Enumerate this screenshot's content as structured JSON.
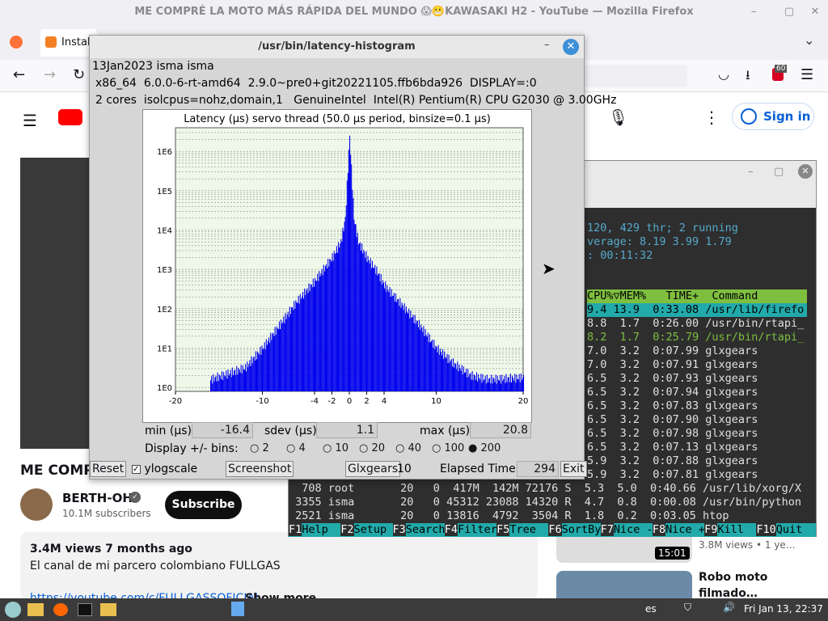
{
  "firefox": {
    "window_title": "ME COMPRÉ LA MOTO MÁS RÁPIDA DEL MUNDO 😱😬KAWASAKI H2 - YouTube — Mozilla Firefox",
    "tab_label": "Instal",
    "badge": "60"
  },
  "youtube": {
    "signin": "Sign in",
    "video_title": "ME COMP",
    "channel": "BERTH-OH",
    "subscribers": "10.1M subscribers",
    "subscribe": "Subscribe",
    "views": "3.4M views  7 months ago",
    "description": "El canal de mi parcero colombiano FULLGAS",
    "link": "https://youtube.com/c/FULLGASSOFICIAL",
    "show_more": "Show more",
    "side_time": "15:01",
    "side_views": "3.8M views  • 1 ye…",
    "side_title1": "Robo moto",
    "side_title2": "filmado…"
  },
  "latency": {
    "title": "/usr/bin/latency-histogram",
    "line1": "13Jan2023 isma isma",
    "line2": "x86_64  6.0.0-6-rt-amd64  2.9.0~pre0+git20221105.ffb6bda926  DISPLAY=:0",
    "line3": "2 cores  isolcpus=nohz,domain,1   GenuineIntel  Intel(R) Pentium(R) CPU G2030 @ 3.00GHz",
    "min_label": "min (µs)",
    "min_value": "-16.4",
    "sdev_label": "sdev (µs)",
    "sdev_value": "1.1",
    "max_label": "max (µs)",
    "max_value": "20.8",
    "bins_label": "Display +/- bins:",
    "bins": [
      "2",
      "4",
      "10",
      "20",
      "40",
      "100",
      "200"
    ],
    "bins_selected": "200",
    "reset": "Reset",
    "ylogscale": "ylogscale",
    "screenshot": "Screenshot",
    "glxgears": "Glxgears",
    "glxgears_count": "10",
    "elapsed_label": "Elapsed Time:",
    "elapsed_value": "294",
    "exit": "Exit"
  },
  "chart_data": {
    "type": "bar",
    "title": "Latency (µs) servo thread (50.0 µs period, binsize=0.1 µs)",
    "xlim": [
      -20,
      20
    ],
    "y_scale": "log",
    "x_ticks": [
      "-20",
      "-10",
      "-4",
      "-2",
      "0",
      "2",
      "4",
      "10",
      "20"
    ],
    "y_ticks": [
      "1E0",
      "1E1",
      "1E2",
      "1E3",
      "1E4",
      "1E5",
      "1E6"
    ],
    "series": [
      {
        "color": "#0000ee",
        "x": [
          -16,
          -12,
          -10,
          -8,
          -6,
          -4,
          -3,
          -2,
          -1,
          -0.5,
          0,
          0.5,
          1,
          2,
          3,
          4,
          6,
          8,
          10,
          12,
          14,
          16,
          20
        ],
        "log10_count": [
          0.2,
          0.5,
          1.0,
          1.6,
          2.2,
          2.7,
          3.0,
          3.3,
          3.7,
          4.3,
          6.4,
          4.3,
          3.7,
          3.3,
          3.0,
          2.6,
          2.1,
          1.6,
          1.0,
          0.6,
          0.3,
          0.2,
          0.25
        ]
      }
    ],
    "grid": true,
    "background": "#eef8e8"
  },
  "htop": {
    "line1": "120, 429 thr; 2 running",
    "line2": "verage: 8.19 3.99 1.79",
    "line3": ": 00:11:32",
    "header": "CPU%▽MEM%   TIME+  Command",
    "rows": [
      "9.4 13.9  0:33.08 /usr/lib/firefo",
      "8.8  1.7  0:26.00 /usr/bin/rtapi_",
      "8.2  1.7  0:25.79 /usr/bin/rtapi_",
      "7.0  3.2  0:07.99 glxgears",
      "7.0  3.2  0:07.91 glxgears",
      "6.5  3.2  0:07.93 glxgears",
      "6.5  3.2  0:07.94 glxgears",
      "6.5  3.2  0:07.83 glxgears",
      "6.5  3.2  0:07.90 glxgears",
      "6.5  3.2  0:07.98 glxgears",
      "6.5  3.2  0:07.13 glxgears",
      "5.9  3.2  0:07.88 glxgears",
      "5.9  3.2  0:07.81 glxgears"
    ],
    "full_rows": [
      "  708 root       20   0  417M  142M 72176 S  5.3  5.0  0:40.66 /usr/lib/xorg/X",
      " 3355 isma       20   0 45312 23088 14320 R  4.7  0.8  0:00.08 /usr/bin/python",
      " 2521 isma       20   0 13816  4792  3504 R  1.8  0.2  0:03.05 htop"
    ],
    "fkeys": [
      [
        "F1",
        "Help"
      ],
      [
        "F2",
        "Setup"
      ],
      [
        "F3",
        "Search"
      ],
      [
        "F4",
        "Filter"
      ],
      [
        "F5",
        "Tree"
      ],
      [
        "F6",
        "SortBy"
      ],
      [
        "F7",
        "Nice -"
      ],
      [
        "F8",
        "Nice +"
      ],
      [
        "F9",
        "Kill"
      ],
      [
        "F10",
        "Quit"
      ]
    ]
  },
  "taskbar": {
    "lang": "es",
    "clock": "Fri Jan 13, 22:37"
  }
}
